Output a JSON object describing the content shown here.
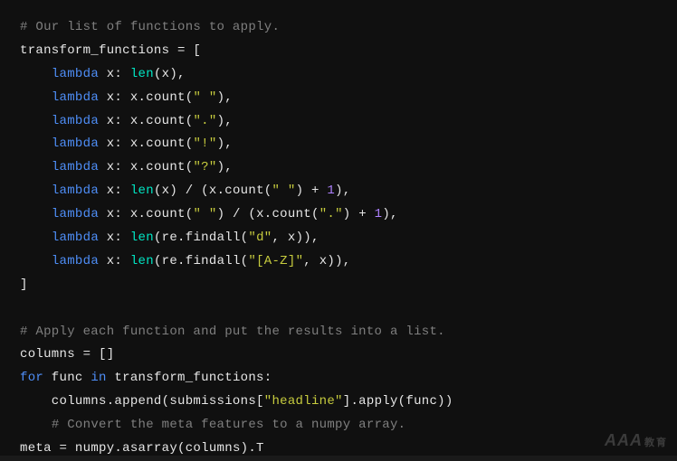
{
  "watermark": {
    "main": "AAA",
    "sub": "教育"
  },
  "code": {
    "lines": [
      [
        {
          "cls": "c",
          "t": "# Our list of functions to apply."
        }
      ],
      [
        {
          "cls": "id",
          "t": "transform_functions"
        },
        {
          "cls": "op",
          "t": " = ["
        }
      ],
      [
        {
          "cls": "op",
          "t": "    "
        },
        {
          "cls": "kw",
          "t": "lambda"
        },
        {
          "cls": "op",
          "t": " x: "
        },
        {
          "cls": "fn",
          "t": "len"
        },
        {
          "cls": "op",
          "t": "(x),"
        }
      ],
      [
        {
          "cls": "op",
          "t": "    "
        },
        {
          "cls": "kw",
          "t": "lambda"
        },
        {
          "cls": "op",
          "t": " x: x.count("
        },
        {
          "cls": "st",
          "t": "\" \""
        },
        {
          "cls": "op",
          "t": "),"
        }
      ],
      [
        {
          "cls": "op",
          "t": "    "
        },
        {
          "cls": "kw",
          "t": "lambda"
        },
        {
          "cls": "op",
          "t": " x: x.count("
        },
        {
          "cls": "st",
          "t": "\".\""
        },
        {
          "cls": "op",
          "t": "),"
        }
      ],
      [
        {
          "cls": "op",
          "t": "    "
        },
        {
          "cls": "kw",
          "t": "lambda"
        },
        {
          "cls": "op",
          "t": " x: x.count("
        },
        {
          "cls": "st",
          "t": "\"!\""
        },
        {
          "cls": "op",
          "t": "),"
        }
      ],
      [
        {
          "cls": "op",
          "t": "    "
        },
        {
          "cls": "kw",
          "t": "lambda"
        },
        {
          "cls": "op",
          "t": " x: x.count("
        },
        {
          "cls": "st",
          "t": "\"?\""
        },
        {
          "cls": "op",
          "t": "),"
        }
      ],
      [
        {
          "cls": "op",
          "t": "    "
        },
        {
          "cls": "kw",
          "t": "lambda"
        },
        {
          "cls": "op",
          "t": " x: "
        },
        {
          "cls": "fn",
          "t": "len"
        },
        {
          "cls": "op",
          "t": "(x) / (x.count("
        },
        {
          "cls": "st",
          "t": "\" \""
        },
        {
          "cls": "op",
          "t": ") + "
        },
        {
          "cls": "nu",
          "t": "1"
        },
        {
          "cls": "op",
          "t": "),"
        }
      ],
      [
        {
          "cls": "op",
          "t": "    "
        },
        {
          "cls": "kw",
          "t": "lambda"
        },
        {
          "cls": "op",
          "t": " x: x.count("
        },
        {
          "cls": "st",
          "t": "\" \""
        },
        {
          "cls": "op",
          "t": ") / (x.count("
        },
        {
          "cls": "st",
          "t": "\".\""
        },
        {
          "cls": "op",
          "t": ") + "
        },
        {
          "cls": "nu",
          "t": "1"
        },
        {
          "cls": "op",
          "t": "),"
        }
      ],
      [
        {
          "cls": "op",
          "t": "    "
        },
        {
          "cls": "kw",
          "t": "lambda"
        },
        {
          "cls": "op",
          "t": " x: "
        },
        {
          "cls": "fn",
          "t": "len"
        },
        {
          "cls": "op",
          "t": "(re.findall("
        },
        {
          "cls": "st",
          "t": "\"d\""
        },
        {
          "cls": "op",
          "t": ", x)),"
        }
      ],
      [
        {
          "cls": "op",
          "t": "    "
        },
        {
          "cls": "kw",
          "t": "lambda"
        },
        {
          "cls": "op",
          "t": " x: "
        },
        {
          "cls": "fn",
          "t": "len"
        },
        {
          "cls": "op",
          "t": "(re.findall("
        },
        {
          "cls": "st",
          "t": "\"[A-Z]\""
        },
        {
          "cls": "op",
          "t": ", x)),"
        }
      ],
      [
        {
          "cls": "op",
          "t": "]"
        }
      ],
      [
        {
          "cls": "op",
          "t": ""
        }
      ],
      [
        {
          "cls": "c",
          "t": "# Apply each function and put the results into a list."
        }
      ],
      [
        {
          "cls": "id",
          "t": "columns"
        },
        {
          "cls": "op",
          "t": " = []"
        }
      ],
      [
        {
          "cls": "kw",
          "t": "for"
        },
        {
          "cls": "op",
          "t": " func "
        },
        {
          "cls": "kw",
          "t": "in"
        },
        {
          "cls": "op",
          "t": " transform_functions:"
        }
      ],
      [
        {
          "cls": "op",
          "t": "    columns.append(submissions["
        },
        {
          "cls": "st",
          "t": "\"headline\""
        },
        {
          "cls": "op",
          "t": "].apply(func))"
        }
      ],
      [
        {
          "cls": "op",
          "t": "    "
        },
        {
          "cls": "c",
          "t": "# Convert the meta features to a numpy array."
        }
      ],
      [
        {
          "cls": "id",
          "t": "meta"
        },
        {
          "cls": "op",
          "t": " = numpy.asarray(columns).T"
        }
      ]
    ]
  }
}
